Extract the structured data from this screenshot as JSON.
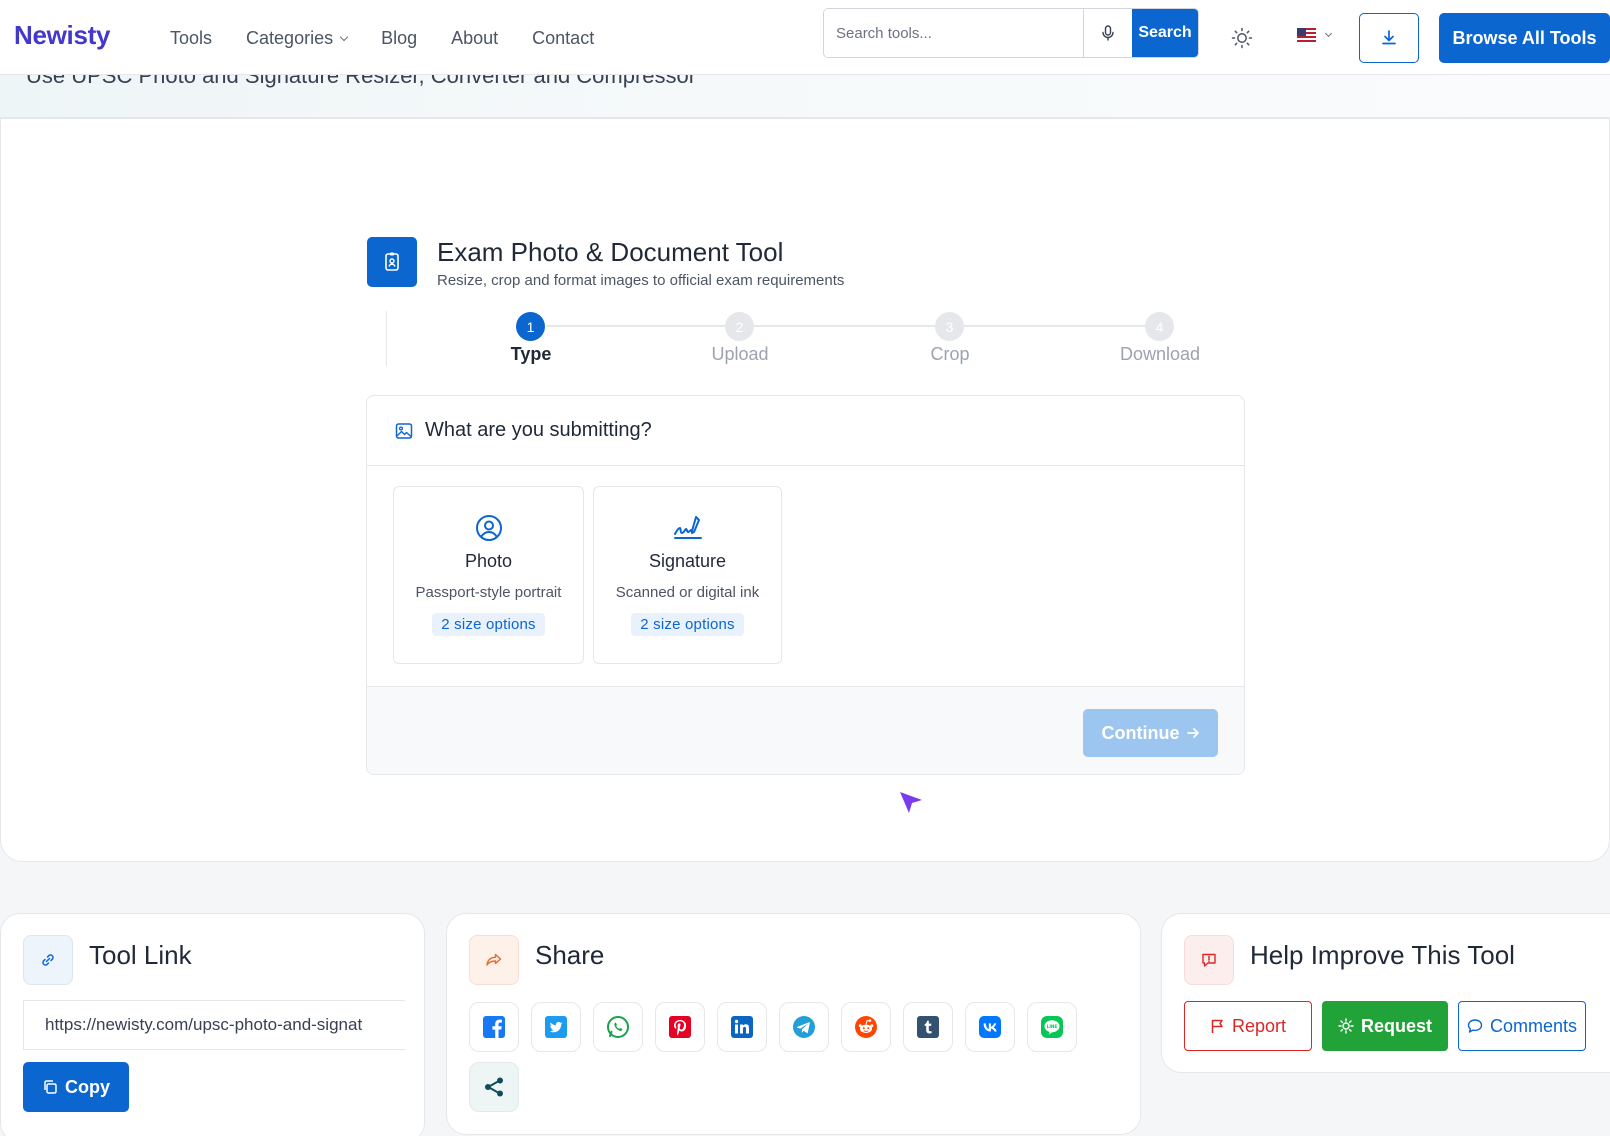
{
  "header": {
    "logo": "Newisty",
    "nav": [
      "Tools",
      "Categories",
      "Blog",
      "About",
      "Contact"
    ],
    "search_placeholder": "Search tools...",
    "search_button": "Search",
    "browse_button": "Browse All Tools"
  },
  "hero": {
    "subtitle": "Use UPSC Photo and Signature Resizer, Converter and Compressor"
  },
  "tool": {
    "title": "Exam Photo & Document Tool",
    "subtitle": "Resize, crop and format images to official exam requirements",
    "steps": [
      {
        "num": "1",
        "label": "Type"
      },
      {
        "num": "2",
        "label": "Upload"
      },
      {
        "num": "3",
        "label": "Crop"
      },
      {
        "num": "4",
        "label": "Download"
      }
    ],
    "question": "What are you submitting?",
    "options": [
      {
        "title": "Photo",
        "subtitle": "Passport-style portrait",
        "badge": "2 size options"
      },
      {
        "title": "Signature",
        "subtitle": "Scanned or digital ink",
        "badge": "2 size options"
      }
    ],
    "continue_button": "Continue"
  },
  "tool_link": {
    "title": "Tool Link",
    "url": "https://newisty.com/upsc-photo-and-signat",
    "copy_button": "Copy"
  },
  "share": {
    "title": "Share",
    "networks": [
      "facebook",
      "twitter",
      "whatsapp",
      "pinterest",
      "linkedin",
      "telegram",
      "reddit",
      "tumblr",
      "vk",
      "line",
      "more"
    ]
  },
  "feedback": {
    "title": "Help Improve This Tool",
    "report_button": "Report",
    "request_button": "Request",
    "comments_button": "Comments"
  },
  "colors": {
    "brand": "#4338ca",
    "primary": "#0b66d0",
    "report": "#dc2626",
    "request": "#22a33a"
  }
}
